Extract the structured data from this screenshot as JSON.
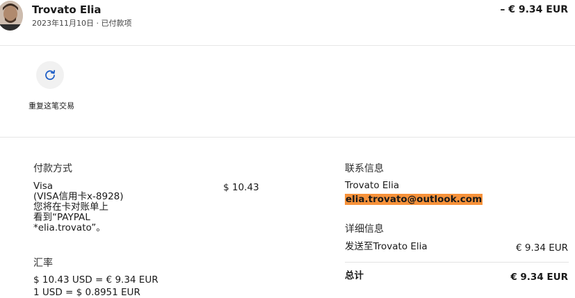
{
  "header": {
    "name": "Trovato Elia",
    "date_status": "2023年11月10日 · 已付款项",
    "amount": "– € 9.34 EUR"
  },
  "actions": {
    "repeat_label": "重复这笔交易"
  },
  "payment": {
    "heading": "付款方式",
    "method_lines": "Visa\n(VISA信用卡x-8928)\n您将在卡对账单上\n看到“PAYPAL\n*elia.trovato”。",
    "method_amount": "$ 10.43",
    "fx_heading": "汇率",
    "fx_line1": "$ 10.43 USD = € 9.34 EUR",
    "fx_line2": "1 USD = $ 0.8951 EUR"
  },
  "contact": {
    "heading": "联系信息",
    "name": "Trovato Elia",
    "email": "elia.trovato@outlook.com"
  },
  "details": {
    "heading": "详细信息",
    "sent_to_label": "发送至Trovato Elia",
    "sent_to_amount": "€ 9.34 EUR",
    "total_label": "总计",
    "total_amount": "€ 9.34 EUR"
  },
  "colors": {
    "accent_blue": "#1f5fc7",
    "highlight": "#f7923a"
  }
}
